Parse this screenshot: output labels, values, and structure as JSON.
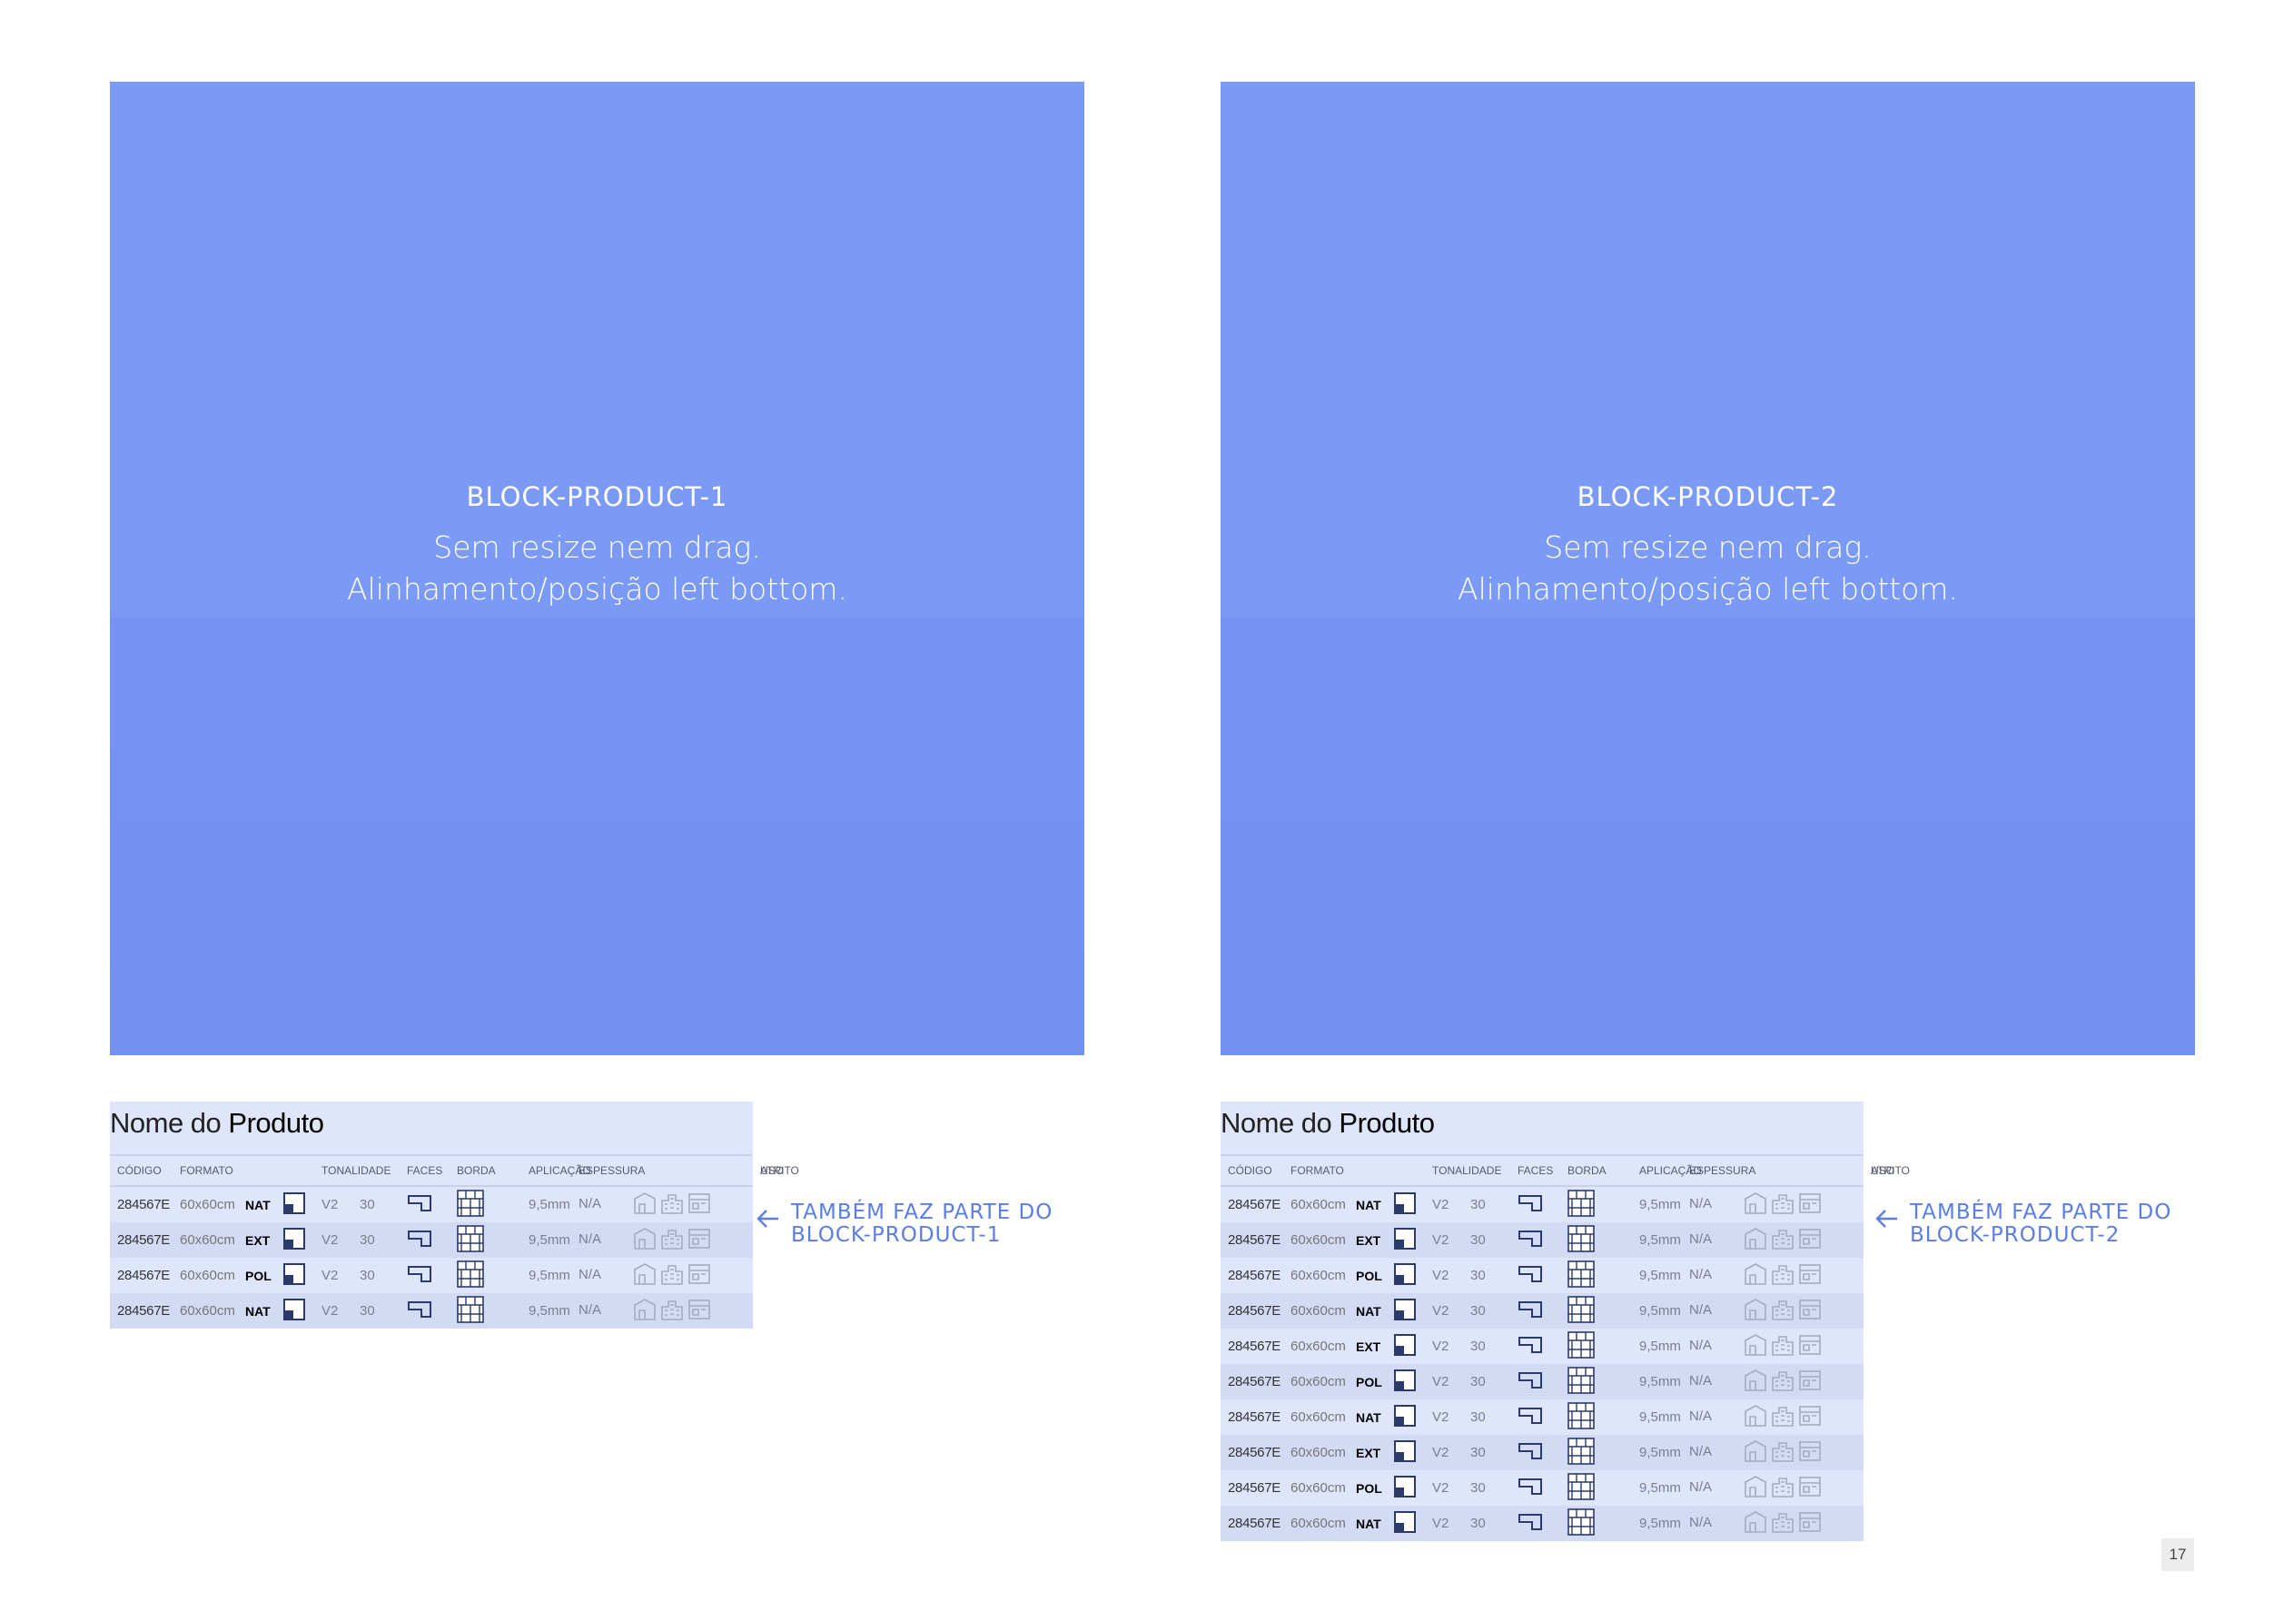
{
  "blocks": [
    {
      "title": "BLOCK-PRODUCT-1",
      "line1": "Sem resize nem drag.",
      "line2": "Alinhamento/posição left bottom."
    },
    {
      "title": "BLOCK-PRODUCT-2",
      "line1": "Sem resize nem drag.",
      "line2": "Alinhamento/posição left bottom."
    }
  ],
  "product": {
    "name_prefix": "Nome do ",
    "name_bold": "Produto"
  },
  "table_headers": [
    "CÓDIGO",
    "FORMATO",
    "TONALIDADE",
    "FACES",
    "BORDA",
    "APLICAÇÃO",
    "ESPESSURA",
    "ATRITO",
    "USO"
  ],
  "table1_rows": [
    {
      "code": "284567E",
      "format": "60x60cm",
      "finish": "NAT",
      "tone": "V2",
      "faces": "30",
      "thickness": "9,5mm",
      "friction": "N/A"
    },
    {
      "code": "284567E",
      "format": "60x60cm",
      "finish": "EXT",
      "tone": "V2",
      "faces": "30",
      "thickness": "9,5mm",
      "friction": "N/A"
    },
    {
      "code": "284567E",
      "format": "60x60cm",
      "finish": "POL",
      "tone": "V2",
      "faces": "30",
      "thickness": "9,5mm",
      "friction": "N/A"
    },
    {
      "code": "284567E",
      "format": "60x60cm",
      "finish": "NAT",
      "tone": "V2",
      "faces": "30",
      "thickness": "9,5mm",
      "friction": "N/A"
    }
  ],
  "table2_rows": [
    {
      "code": "284567E",
      "format": "60x60cm",
      "finish": "NAT",
      "tone": "V2",
      "faces": "30",
      "thickness": "9,5mm",
      "friction": "N/A"
    },
    {
      "code": "284567E",
      "format": "60x60cm",
      "finish": "EXT",
      "tone": "V2",
      "faces": "30",
      "thickness": "9,5mm",
      "friction": "N/A"
    },
    {
      "code": "284567E",
      "format": "60x60cm",
      "finish": "POL",
      "tone": "V2",
      "faces": "30",
      "thickness": "9,5mm",
      "friction": "N/A"
    },
    {
      "code": "284567E",
      "format": "60x60cm",
      "finish": "NAT",
      "tone": "V2",
      "faces": "30",
      "thickness": "9,5mm",
      "friction": "N/A"
    },
    {
      "code": "284567E",
      "format": "60x60cm",
      "finish": "EXT",
      "tone": "V2",
      "faces": "30",
      "thickness": "9,5mm",
      "friction": "N/A"
    },
    {
      "code": "284567E",
      "format": "60x60cm",
      "finish": "POL",
      "tone": "V2",
      "faces": "30",
      "thickness": "9,5mm",
      "friction": "N/A"
    },
    {
      "code": "284567E",
      "format": "60x60cm",
      "finish": "NAT",
      "tone": "V2",
      "faces": "30",
      "thickness": "9,5mm",
      "friction": "N/A"
    },
    {
      "code": "284567E",
      "format": "60x60cm",
      "finish": "EXT",
      "tone": "V2",
      "faces": "30",
      "thickness": "9,5mm",
      "friction": "N/A"
    },
    {
      "code": "284567E",
      "format": "60x60cm",
      "finish": "POL",
      "tone": "V2",
      "faces": "30",
      "thickness": "9,5mm",
      "friction": "N/A"
    },
    {
      "code": "284567E",
      "format": "60x60cm",
      "finish": "NAT",
      "tone": "V2",
      "faces": "30",
      "thickness": "9,5mm",
      "friction": "N/A"
    }
  ],
  "notes": [
    {
      "line1": "TAMBÉM FAZ PARTE DO",
      "line2": "BLOCK-PRODUCT-1"
    },
    {
      "line1": "TAMBÉM FAZ PARTE DO",
      "line2": "BLOCK-PRODUCT-2"
    }
  ],
  "icons": {
    "tone": "tone-swatch-icon",
    "edge": "rectified-edge-icon",
    "application": "wall-floor-grid-icon",
    "use": [
      "residential-use-icon",
      "commercial-use-icon",
      "industrial-use-icon"
    ]
  },
  "colors": {
    "block": "#7b9af6",
    "table_light": "#dfe5fb",
    "table_dark": "#d3daf4",
    "accent": "#5b7de6"
  },
  "page_number": "17"
}
